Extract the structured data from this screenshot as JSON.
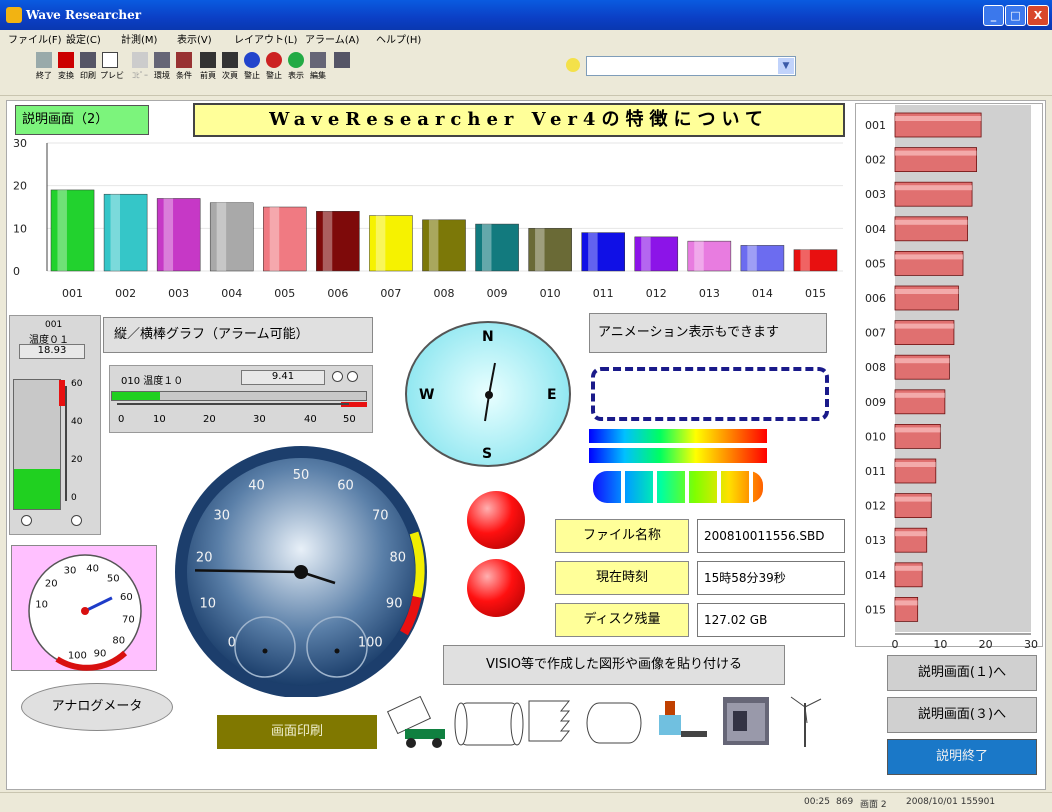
{
  "window": {
    "title": "Wave Researcher",
    "btn_min": "_",
    "btn_max": "□",
    "btn_close": "X"
  },
  "menu": [
    "ファイル(F)",
    "設定(C)",
    "計測(M)",
    "表示(V)",
    "レイアウト(L)",
    "アラーム(A)",
    "ヘルプ(H)"
  ],
  "toolbar": [
    "終了",
    "変換",
    "印刷",
    "プレビ",
    "ｺﾋﾟｰ",
    "環境",
    "条件",
    "前頁",
    "次頁",
    "警止",
    "警止",
    "表示",
    "編集"
  ],
  "header": {
    "screen_label": "説明画面（2）",
    "title": "WaveResearcher Ver4の特徴について"
  },
  "bar_chart": {
    "type": "bar",
    "categories": [
      "001",
      "002",
      "003",
      "004",
      "005",
      "006",
      "007",
      "008",
      "009",
      "010",
      "011",
      "012",
      "013",
      "014",
      "015"
    ],
    "values": [
      19,
      18,
      17,
      16,
      15,
      14,
      13,
      12,
      11,
      10,
      9,
      8,
      7,
      6,
      5
    ],
    "colors": [
      "#22d22e",
      "#35c6c8",
      "#c638c6",
      "#a9a9a9",
      "#f07a82",
      "#7e0a0a",
      "#f6f200",
      "#7c7808",
      "#127a7e",
      "#6a6a36",
      "#1010e6",
      "#8c14e8",
      "#e87ce0",
      "#6c6cf0",
      "#e81010"
    ],
    "ylim": [
      0,
      30
    ],
    "yticks": [
      "0",
      "10",
      "20",
      "30"
    ]
  },
  "hbar_chart": {
    "type": "bar",
    "categories": [
      "001",
      "002",
      "003",
      "004",
      "005",
      "006",
      "007",
      "008",
      "009",
      "010",
      "011",
      "012",
      "013",
      "014",
      "015"
    ],
    "values": [
      19,
      18,
      17,
      16,
      15,
      14,
      13,
      12,
      11,
      10,
      9,
      8,
      7,
      6,
      5
    ],
    "xticks": [
      "0",
      "10",
      "20",
      "30"
    ],
    "xlim": [
      0,
      30
    ],
    "color": "#e07070"
  },
  "vgauge": {
    "id": "001",
    "name": "温度０１",
    "value": "18.93",
    "ticks": [
      "60",
      "40",
      "20",
      "0"
    ],
    "fill_fraction": 0.31
  },
  "graph_label": "縦／横棒グラフ（アラーム可能）",
  "hgauge": {
    "name": "010 温度１０",
    "value": "9.41",
    "ticks": [
      "0",
      "10",
      "20",
      "30",
      "40",
      "50"
    ],
    "fill_fraction": 0.19
  },
  "compass": {
    "n": "N",
    "s": "S",
    "e": "E",
    "w": "W"
  },
  "animation_label": "アニメーション表示もできます",
  "info": [
    {
      "label": "ファイル名称",
      "value": "200810011556.SBD"
    },
    {
      "label": "現在時刻",
      "value": "15時58分39秒"
    },
    {
      "label": "ディスク残量",
      "value": "127.02 GB"
    }
  ],
  "speedometer": {
    "ticks": [
      "0",
      "10",
      "20",
      "30",
      "40",
      "50",
      "60",
      "70",
      "80",
      "90",
      "100"
    ],
    "value": 17
  },
  "small_meter": {
    "ticks": [
      "10",
      "20",
      "30",
      "40",
      "50",
      "60",
      "70",
      "80",
      "90",
      "100"
    ],
    "value": 58
  },
  "analog_label": "アナログメータ",
  "print_label": "画面印刷",
  "visio_label": "VISIO等で作成した図形や画像を貼り付ける",
  "nav": {
    "prev": "説明画面(１)へ",
    "next": "説明画面(３)へ",
    "end": "説明終了"
  },
  "status": {
    "time": "00:25",
    "count": "869",
    "screen": "画面 2",
    "datetime": "2008/10/01 155901"
  }
}
